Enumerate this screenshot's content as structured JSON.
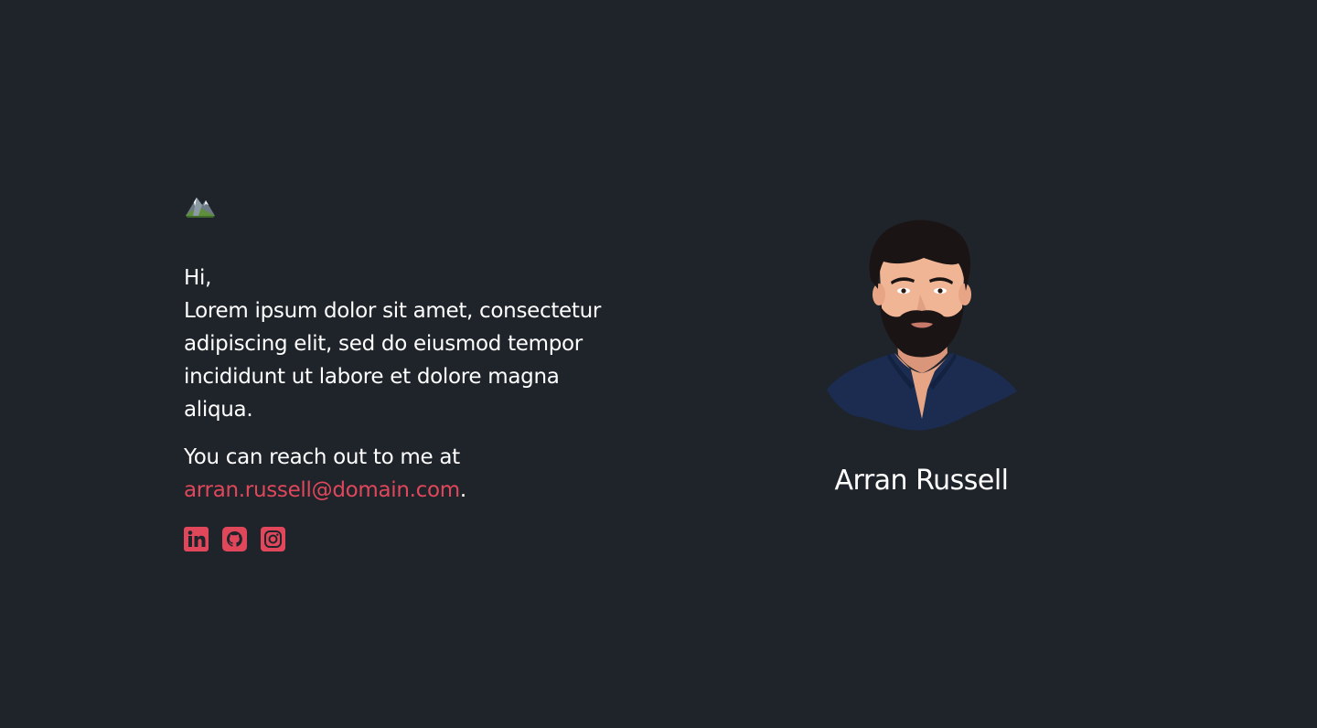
{
  "logo": {
    "icon": "mountain-icon"
  },
  "intro": {
    "greeting": "Hi,",
    "text": "Lorem ipsum dolor sit amet, consectetur adipiscing elit, sed do eiusmod tempor incididunt ut labore et dolore magna aliqua."
  },
  "contact": {
    "prefix": "You can reach out to me at",
    "email": "arran.russell@domain.com",
    "suffix": "."
  },
  "socials": [
    {
      "icon": "linkedin-icon"
    },
    {
      "icon": "github-icon"
    },
    {
      "icon": "instagram-icon"
    }
  ],
  "profile": {
    "name": "Arran Russell"
  },
  "colors": {
    "background": "#1f242b",
    "text": "#ffffff",
    "accent": "#e0475b",
    "shirt": "#1b2c50"
  }
}
